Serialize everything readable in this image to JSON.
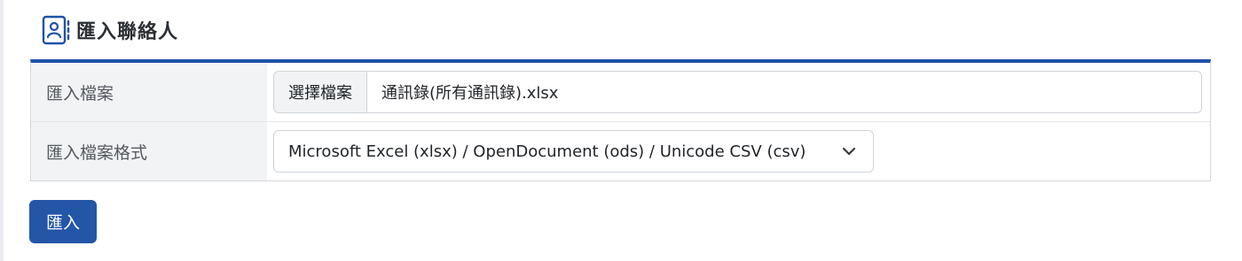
{
  "header": {
    "title": "匯入聯絡人",
    "icon": "contact-book-icon"
  },
  "form": {
    "rows": [
      {
        "label": "匯入檔案",
        "file_button_label": "選擇檔案",
        "file_name": "通訊錄(所有通訊錄).xlsx"
      },
      {
        "label": "匯入檔案格式",
        "selected_option": "Microsoft Excel (xlsx) / OpenDocument (ods) / Unicode CSV (csv)",
        "icon": "chevron-down-icon"
      }
    ]
  },
  "actions": {
    "submit_label": "匯入"
  },
  "colors": {
    "accent": "#1f52a8",
    "button": "#2456a8",
    "label_bg": "#f2f3f5"
  }
}
